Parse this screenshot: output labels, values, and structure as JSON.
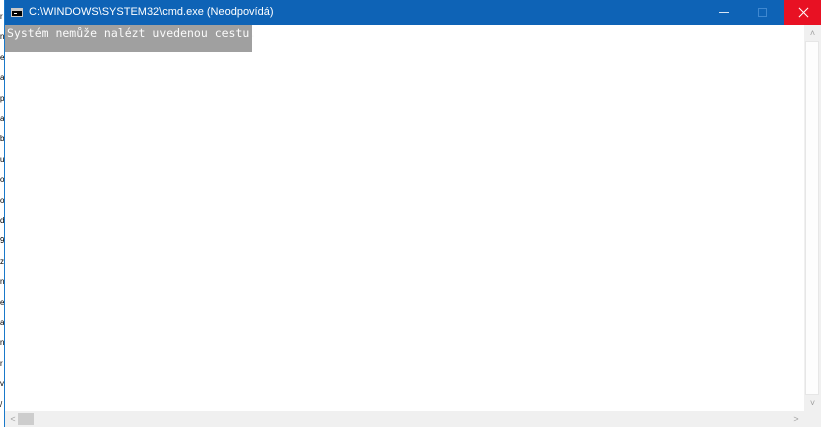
{
  "window": {
    "title": "C:\\WINDOWS\\SYSTEM32\\cmd.exe (Neodpovídá)",
    "icon": "cmd-icon"
  },
  "titlebar_buttons": {
    "minimize_icon": "minimize-icon",
    "maximize_icon": "maximize-icon",
    "close_icon": "close-icon"
  },
  "console": {
    "lines": [
      "Systém nemůže nalézt uvedenou cestu."
    ]
  },
  "background_window_chars": [
    "r",
    "n",
    "e",
    "a",
    "p",
    "a",
    "b",
    "u",
    "o",
    "o",
    "d",
    "9",
    "z",
    "n",
    "e",
    "a",
    "n",
    "r",
    "v",
    "/"
  ],
  "scrollbars": {
    "up_arrow": "˄",
    "down_arrow": "˅",
    "left_arrow": "<",
    "right_arrow": ">"
  },
  "colors": {
    "titlebar": "#0e63b6",
    "close_hover": "#e81123",
    "selection": "#a0a0a0"
  }
}
